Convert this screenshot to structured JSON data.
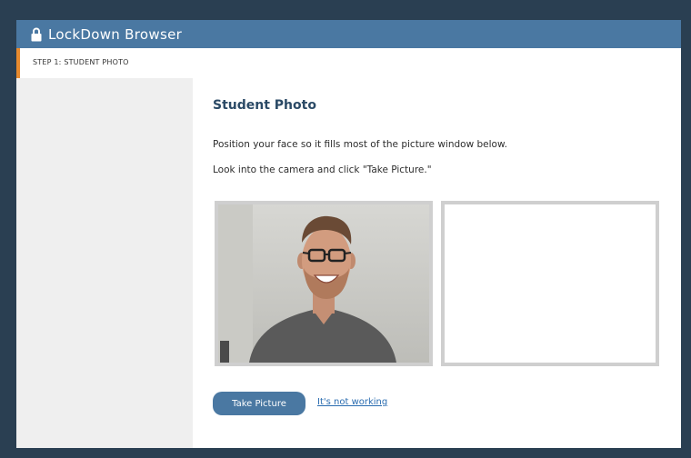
{
  "app": {
    "title": "LockDown Browser",
    "icon": "lock-icon"
  },
  "sidebar": {
    "steps": [
      {
        "label": "STEP 1: STUDENT PHOTO",
        "active": true
      }
    ]
  },
  "main": {
    "heading": "Student Photo",
    "instructions": [
      "Position your face so it fills most of the picture window below.",
      "Look into the camera and click \"Take Picture.\""
    ],
    "take_picture_label": "Take Picture",
    "not_working_label": "It's not working"
  },
  "colors": {
    "background": "#2a3f52",
    "titlebar": "#4a78a2",
    "accent": "#e78a2e",
    "heading": "#2b4a66",
    "button": "#4a78a2",
    "link": "#2a6cb0"
  }
}
